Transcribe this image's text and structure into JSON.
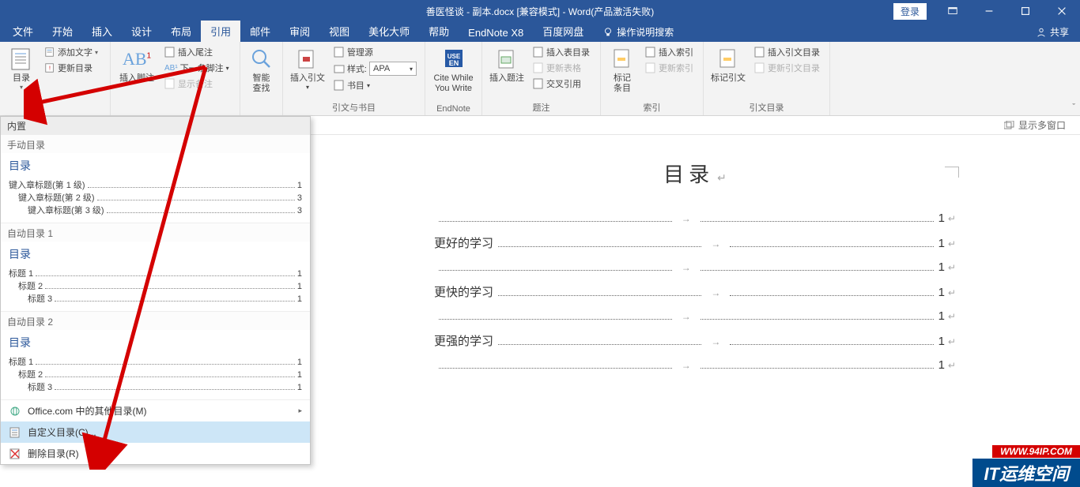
{
  "titlebar": {
    "title": "善医怪谈 - 副本.docx [兼容模式] - Word(产品激活失败)",
    "login": "登录"
  },
  "tabs": {
    "file": "文件",
    "home": "开始",
    "insert": "插入",
    "design": "设计",
    "layout": "布局",
    "references": "引用",
    "mailings": "邮件",
    "review": "审阅",
    "view": "视图",
    "beautify": "美化大师",
    "help": "帮助",
    "endnote": "EndNote X8",
    "baidu": "百度网盘",
    "tell_me": "操作说明搜索",
    "share": "共享"
  },
  "ribbon": {
    "toc_btn": "目录",
    "add_text": "添加文字",
    "update_toc": "更新目录",
    "insert_footnote": "插入脚注",
    "insert_endnote": "插入尾注",
    "next_footnote": "下一条脚注",
    "show_notes": "显示备注",
    "smart_lookup": "智能\n查找",
    "insert_citation": "插入引文",
    "manage_sources": "管理源",
    "style_label": "样式:",
    "style_value": "APA",
    "bibliography": "书目",
    "cite_while": "Cite While\nYou Write",
    "insert_caption": "插入题注",
    "insert_tof": "插入表目录",
    "update_table": "更新表格",
    "cross_ref": "交叉引用",
    "mark_entry": "标记\n条目",
    "insert_index": "插入索引",
    "update_index": "更新索引",
    "mark_citation": "标记引文",
    "insert_toa": "插入引文目录",
    "update_toa": "更新引文目录",
    "group_citations": "引文与书目",
    "group_endnote": "EndNote",
    "group_captions": "题注",
    "group_index": "索引",
    "group_toa": "引文目录",
    "multi_window": "显示多窗口"
  },
  "toc_panel": {
    "builtin": "内置",
    "manual": "手动目录",
    "toc_word": "目录",
    "l1": "键入章标题(第 1 级)",
    "l2": "键入章标题(第 2 级)",
    "l3": "键入章标题(第 3 级)",
    "pg1": "1",
    "pg2": "3",
    "pg3": "3",
    "auto1": "自动目录 1",
    "auto2": "自动目录 2",
    "h1": "标题 1",
    "h2": "标题 2",
    "h3": "标题 3",
    "apg": "1",
    "office_more": "Office.com 中的其他目录(M)",
    "custom": "自定义目录(C)...",
    "remove": "删除目录(R)"
  },
  "doc": {
    "title": "目录",
    "line2": "更好的学习",
    "line4": "更快的学习",
    "line6": "更强的学习",
    "pg": "1",
    "arrow": "→",
    "ret": "↵"
  },
  "watermark": {
    "url": "WWW.94IP.COM",
    "it": "IT运维空间"
  }
}
